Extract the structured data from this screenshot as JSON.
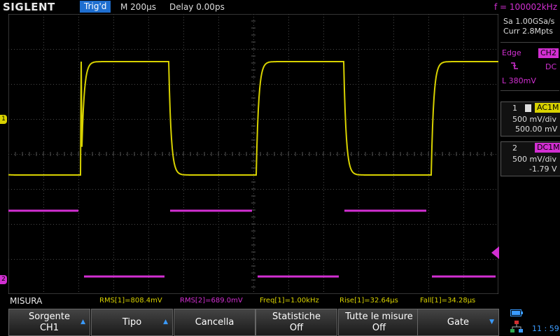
{
  "topbar": {
    "brand": "SIGLENT",
    "trig_status": "Trig'd",
    "timebase": "M 200μs",
    "delay": "Delay 0.00ps",
    "frequency": "f = 100002kHz"
  },
  "acquisition": {
    "sample_rate": "Sa 1.00GSa/s",
    "memory": "Curr 2.8Mpts"
  },
  "trigger": {
    "type": "Edge",
    "source": "CH2",
    "slope_icon": "falling-edge-icon",
    "coupling": "DC",
    "level": "L  380mV"
  },
  "channels": [
    {
      "number": "1",
      "coupling": "AC1M",
      "scale": "500 mV/div",
      "offset": "500.00 mV",
      "color": "#d8d200"
    },
    {
      "number": "2",
      "coupling": "DC1M",
      "scale": "500 mV/div",
      "offset": "-1.79 V",
      "color": "#d22fd2"
    }
  ],
  "markers": {
    "ch1": "1",
    "ch2": "2"
  },
  "measure": {
    "title": "MISURA",
    "items": [
      {
        "text": "RMS[1]=808.4mV",
        "channel": 1
      },
      {
        "text": "RMS[2]=689.0mV",
        "channel": 2
      },
      {
        "text": "Freq[1]=1.00kHz",
        "channel": 1
      },
      {
        "text": "Rise[1]=32.64μs",
        "channel": 1
      },
      {
        "text": "Fall[1]=34.28μs",
        "channel": 1
      }
    ]
  },
  "softkeys": [
    {
      "line1": "Sorgente",
      "line2": "CH1",
      "arrow": true
    },
    {
      "line1": "Tipo",
      "line2": "",
      "arrow": true
    },
    {
      "line1": "Cancella",
      "line2": "",
      "arrow": false
    },
    {
      "line1": "Statistiche",
      "line2": "Off",
      "arrow": false
    },
    {
      "line1": "Tutte le misure",
      "line2": "Off",
      "arrow": false
    },
    {
      "line1": "Gate",
      "line2": "",
      "arrow": true
    }
  ],
  "status": {
    "clock": "11 : 59",
    "icons": [
      "battery-icon",
      "network-icon"
    ]
  },
  "colors": {
    "ch1": "#d8d200",
    "ch2": "#d22fd2",
    "accent": "#1f6fd0"
  }
}
